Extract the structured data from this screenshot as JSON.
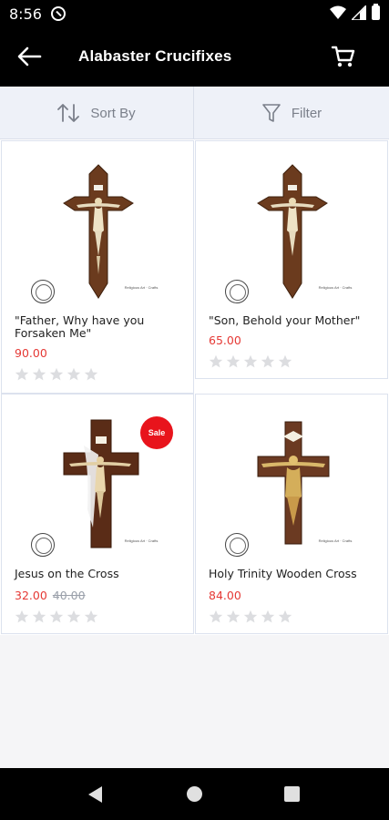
{
  "status_bar": {
    "time": "8:56"
  },
  "app_bar": {
    "title": "Alabaster Crucifixes",
    "back_icon": "arrow-left-icon",
    "cart_icon": "cart-icon"
  },
  "toolbar": {
    "sort_label": "Sort By",
    "filter_label": "Filter"
  },
  "products": [
    {
      "name": "\"Father, Why have you Forsaken Me\"",
      "price": "90.00",
      "old_price": "",
      "rating": 0,
      "sale": false
    },
    {
      "name": "\"Son, Behold your Mother\"",
      "price": "65.00",
      "old_price": "",
      "rating": 0,
      "sale": false
    },
    {
      "name": "Jesus on the Cross",
      "price": "32.00",
      "old_price": "40.00",
      "rating": 0,
      "sale": true,
      "sale_label": "Sale"
    },
    {
      "name": "Holy Trinity Wooden Cross",
      "price": "84.00",
      "old_price": "",
      "rating": 0,
      "sale": false
    }
  ],
  "colors": {
    "accent_price": "#e53935",
    "sale_badge": "#e8141c",
    "bar_background": "#000000"
  }
}
